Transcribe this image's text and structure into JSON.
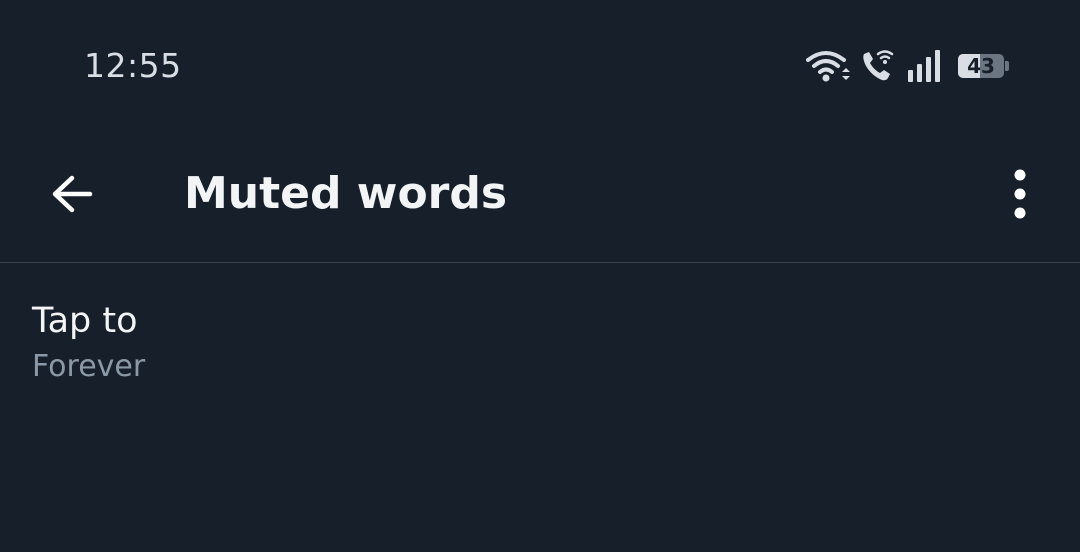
{
  "status_bar": {
    "time": "12:55",
    "battery_level": "43",
    "icons": [
      "wifi-icon",
      "wifi-calling-icon",
      "signal-icon",
      "battery-icon"
    ]
  },
  "header": {
    "back_icon": "arrow-left-icon",
    "title": "Muted words",
    "more_icon": "more-vertical-icon"
  },
  "muted_list": [
    {
      "title": "Tap to",
      "duration": "Forever"
    }
  ],
  "colors": {
    "background": "#17202a",
    "primary_text": "#f2f4f6",
    "secondary_text": "#8b98a5",
    "divider": "#38444d"
  }
}
